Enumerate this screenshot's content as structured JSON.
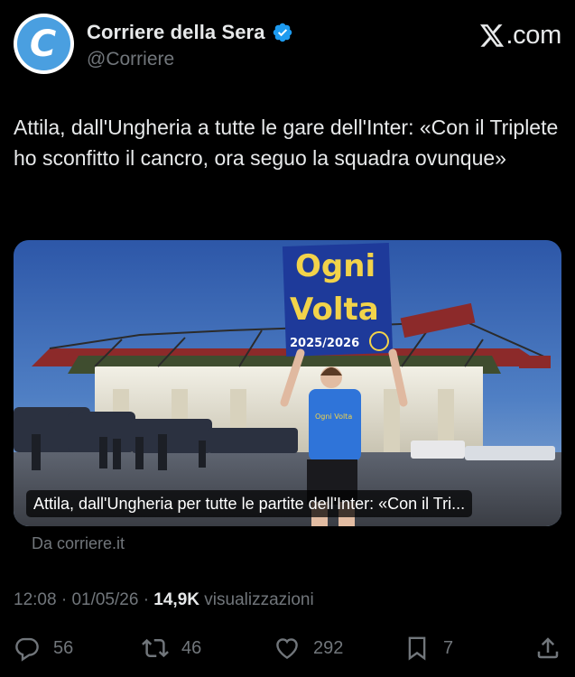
{
  "author": {
    "display_name": "Corriere della Sera",
    "handle": "@Corriere",
    "avatar_letter": "C",
    "verified": true
  },
  "brand": {
    "text": ".com"
  },
  "tweet": {
    "text": "Attila, dall'Ungheria a tutte le gare dell'Inter: «Con il Triplete ho sconfitto il cancro, ora seguo la squadra ovunque»"
  },
  "card": {
    "caption": "Attila, dall'Ungheria per tutte le partite dell'Inter: «Con il Tri...",
    "banner_line1": "Ogni",
    "banner_line2": "Volta",
    "banner_season": "2025/2026",
    "shirt_text": "Ogni Volta"
  },
  "source": "Da corriere.it",
  "meta": {
    "time": "12:08",
    "date": "01/05/26",
    "views_count": "14,9K",
    "views_label": "visualizzazioni"
  },
  "actions": {
    "replies": "56",
    "reposts": "46",
    "likes": "292",
    "bookmarks": "7"
  },
  "colors": {
    "background": "#000000",
    "text": "#e7e9ea",
    "secondary": "#71767b",
    "verified": "#1d9bf0",
    "avatar": "#4a9fe0"
  }
}
